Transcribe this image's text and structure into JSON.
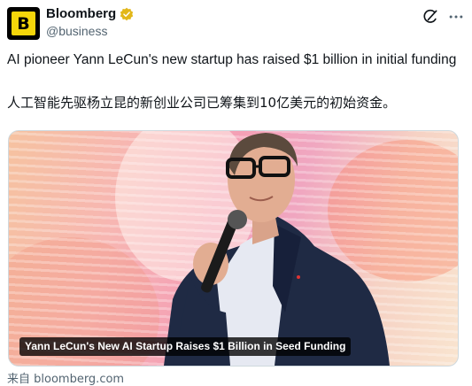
{
  "account": {
    "avatar_letter": "B",
    "display_name": "Bloomberg",
    "handle": "@business",
    "verified_color": "#e2b719",
    "avatar_color": "#f5d60a"
  },
  "post": {
    "text_en": "AI pioneer Yann LeCun's new startup has raised $1 billion in initial funding",
    "text_zh": "人工智能先驱杨立昆的新创业公司已筹集到10亿美元的初始资金。",
    "media_caption": "Yann LeCun's New AI Startup Raises $1 Billion in Seed Funding",
    "source": "来自 bloomberg.com"
  },
  "icons": {
    "grok": "grok-icon",
    "more": "more-options-icon",
    "verified": "verified-badge-icon"
  }
}
